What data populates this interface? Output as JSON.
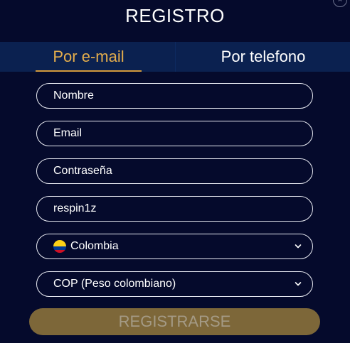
{
  "dialog": {
    "title": "REGISTRO",
    "close_glyph": "×"
  },
  "tabs": [
    {
      "label": "Por e-mail",
      "active": true
    },
    {
      "label": "Por telefono",
      "active": false
    }
  ],
  "form": {
    "name_placeholder": "Nombre",
    "email_placeholder": "Email",
    "password_placeholder": "Contraseña",
    "promo_value": "respin1z",
    "country": {
      "value": "Colombia",
      "icon": "colombia-flag-icon"
    },
    "currency": {
      "value": "COP (Peso colombiano)",
      "icon": "chevron-down-icon"
    },
    "submit_label": "REGISTRARSE"
  },
  "colors": {
    "background": "#050a2c",
    "tab_bar": "#0b2150",
    "active_tab": "#e4ad4c",
    "submit_button": "#7d6739",
    "submit_text": "#a49a85"
  }
}
